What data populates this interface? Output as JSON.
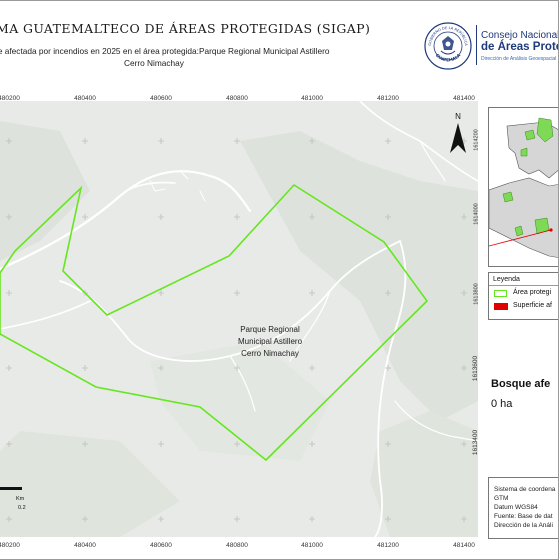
{
  "header": {
    "title": "MA GUATEMALTECO DE ÁREAS PROTEGIDAS  (SIGAP)",
    "subtitle_line1": "ie afectada por incendios en 2025 en el área protegida:Parque Regional Municipal Astillero",
    "subtitle_line2": "Cerro Nimachay",
    "logo_line1": "Consejo Nacional",
    "logo_line2": "de Áreas Protegid",
    "logo_line3": "Dirección de Análisis Geoespacial",
    "seal_text_top": "GOBIERNO DE LA REPÚBLICA",
    "seal_text_bottom": "GUATEMALA"
  },
  "map": {
    "x_ticks": [
      "480200",
      "480400",
      "480600",
      "480800",
      "481000",
      "481200",
      "481400"
    ],
    "y_ticks": [
      "1613600",
      "1613400"
    ],
    "area_label_line1": "Parque Regional",
    "area_label_line2": "Municipal Astillero",
    "area_label_line3": "Cerro Nimachay",
    "north_label": "N",
    "scale_unit": "Km",
    "scale_value": "0.2",
    "colors": {
      "background": "#e9ebe8",
      "forest": "#dfe5de",
      "roads": "#ffffff",
      "protected_area_outline": "#66e61e"
    }
  },
  "inset": {
    "y_ticks": [
      "1614200",
      "1614000",
      "1613800"
    ]
  },
  "legend": {
    "title": "Leyenda",
    "items": [
      {
        "label": "Área protegi",
        "swatch": "outline",
        "color": "#66e61e"
      },
      {
        "label": "Superficie af",
        "swatch": "fill",
        "color": "#e00000"
      }
    ]
  },
  "summary": {
    "title": "Bosque afe",
    "value": "0 ha"
  },
  "info": {
    "lines": [
      "Sistema de coordena",
      "GTM",
      "Datum WGS84",
      "Fuente: Base de dat",
      "Dirección de la Análi"
    ]
  }
}
